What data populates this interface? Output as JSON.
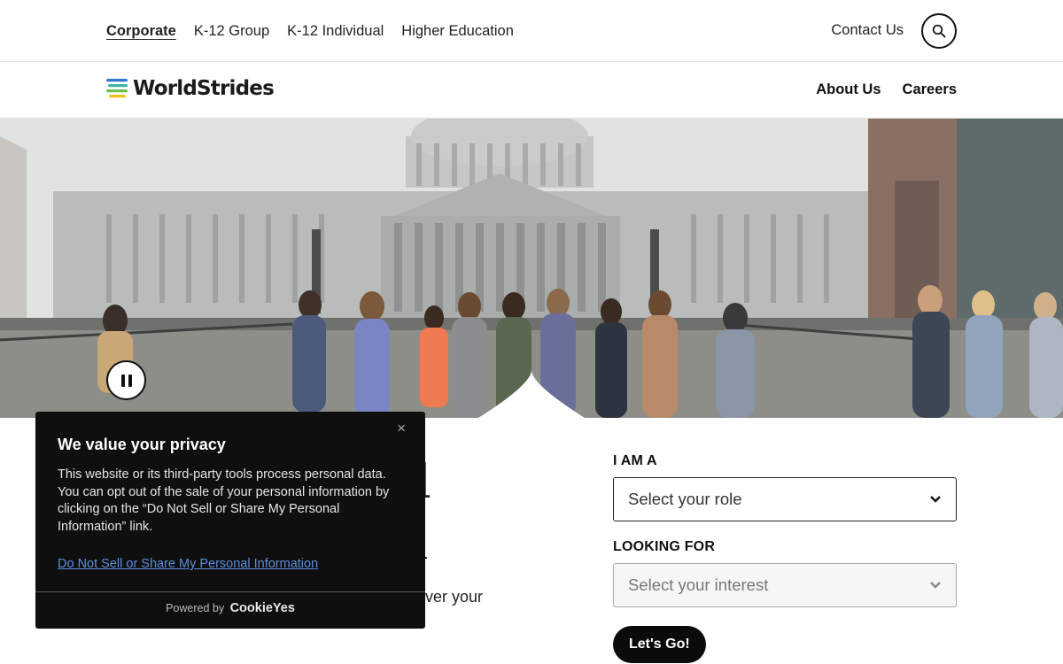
{
  "topbar": {
    "nav": [
      {
        "label": "Corporate",
        "active": true
      },
      {
        "label": "K-12 Group",
        "active": false
      },
      {
        "label": "K-12 Individual",
        "active": false
      },
      {
        "label": "Higher Education",
        "active": false
      }
    ],
    "contact_label": "Contact Us",
    "search_icon": "search-icon"
  },
  "mainbar": {
    "logo_text": "WorldStrides",
    "logo_mark": "worldstrides-stripes-logo",
    "nav": [
      "About Us",
      "Careers"
    ]
  },
  "hero": {
    "pause_icon": "pause-icon",
    "colors": {
      "sky": "#e2e6e4",
      "building": "#b9bdbb",
      "plaza": "#8f908a"
    }
  },
  "main": {
    "partial_heading": "l",
    "partial_text": "ver your"
  },
  "form": {
    "role_label": "I AM A",
    "role_placeholder": "Select your role",
    "interest_label": "LOOKING FOR",
    "interest_placeholder": "Select your interest",
    "submit_label": "Let's Go!"
  },
  "cookie": {
    "title": "We value your privacy",
    "body": "This website or its third-party tools process personal data. You can opt out of the sale of your personal information by clicking on the “Do Not Sell or Share My Personal Information” link.",
    "link": "Do Not Sell or Share My Personal Information",
    "powered_by": "Powered by",
    "brand": "CookieYes",
    "close": "×"
  }
}
